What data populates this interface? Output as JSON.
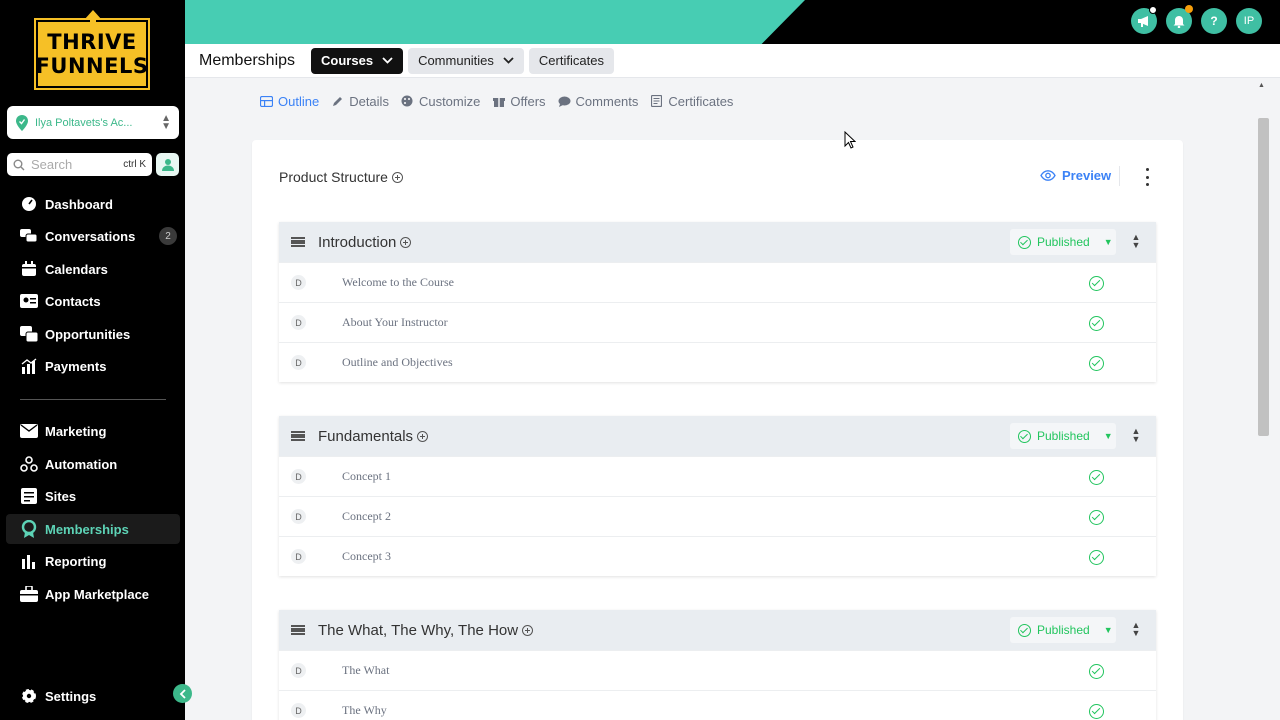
{
  "brand": {
    "line1": "THRIVE",
    "line2": "FUNNELS"
  },
  "account": {
    "name": "Ilya Poltavets's Ac..."
  },
  "search": {
    "placeholder": "Search",
    "shortcut": "ctrl K"
  },
  "sidebar": {
    "items": [
      {
        "label": "Dashboard",
        "icon": "dashboard-icon"
      },
      {
        "label": "Conversations",
        "icon": "chat-icon",
        "badge": "2"
      },
      {
        "label": "Calendars",
        "icon": "calendar-icon"
      },
      {
        "label": "Contacts",
        "icon": "contacts-icon"
      },
      {
        "label": "Opportunities",
        "icon": "opportunities-icon"
      },
      {
        "label": "Payments",
        "icon": "payments-icon"
      },
      {
        "label": "Marketing",
        "icon": "mail-icon"
      },
      {
        "label": "Automation",
        "icon": "automation-icon"
      },
      {
        "label": "Sites",
        "icon": "sites-icon"
      },
      {
        "label": "Memberships",
        "icon": "memberships-icon",
        "active": true
      },
      {
        "label": "Reporting",
        "icon": "reporting-icon"
      },
      {
        "label": "App Marketplace",
        "icon": "marketplace-icon"
      }
    ],
    "settings": "Settings"
  },
  "topbar": {
    "avatar_initials": "IP",
    "help": "?"
  },
  "header": {
    "title": "Memberships",
    "courses": "Courses",
    "communities": "Communities",
    "certificates": "Certificates"
  },
  "subtabs": [
    {
      "label": "Outline",
      "active": true
    },
    {
      "label": "Details"
    },
    {
      "label": "Customize"
    },
    {
      "label": "Offers"
    },
    {
      "label": "Comments"
    },
    {
      "label": "Certificates"
    }
  ],
  "card": {
    "title": "Product Structure",
    "preview": "Preview"
  },
  "sections": [
    {
      "title": "Introduction",
      "status": "Published",
      "lessons": [
        "Welcome to the Course",
        "About Your Instructor",
        "Outline and Objectives"
      ]
    },
    {
      "title": "Fundamentals",
      "status": "Published",
      "lessons": [
        "Concept 1",
        "Concept 2",
        "Concept 3"
      ]
    },
    {
      "title": "The What, The Why, The How",
      "status": "Published",
      "lessons": [
        "The What",
        "The Why"
      ]
    }
  ],
  "lesson_type_letter": "D",
  "colors": {
    "accent": "#47cdb3",
    "active_nav": "#5dd3b6",
    "published": "#22c55e",
    "link": "#3b82f6"
  }
}
